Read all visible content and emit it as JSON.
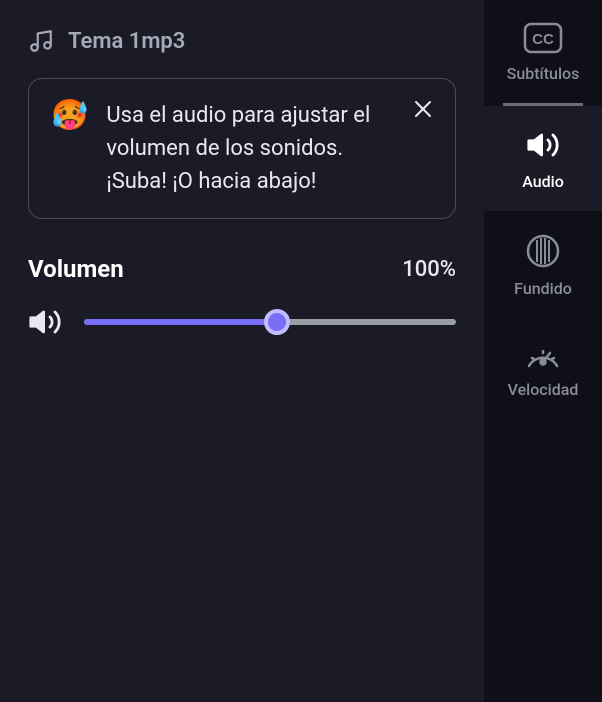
{
  "file": {
    "name": "Tema 1mp3"
  },
  "tip": {
    "emoji": "🥵",
    "text": "Usa el audio para ajustar el volumen de los sonidos. ¡Suba! ¡O hacia abajo!"
  },
  "volume": {
    "label": "Volumen",
    "value_display": "100%",
    "fill_percent": 52
  },
  "sidebar": {
    "items": [
      {
        "label": "Subtítulos"
      },
      {
        "label": "Audio"
      },
      {
        "label": "Fundido"
      },
      {
        "label": "Velocidad"
      }
    ]
  }
}
